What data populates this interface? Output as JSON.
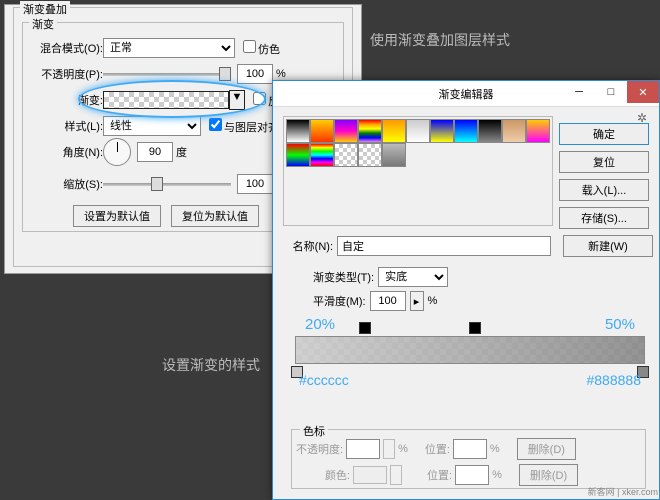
{
  "panel": {
    "title": "渐变叠加",
    "inner": "渐变",
    "blend": {
      "label": "混合模式(O):",
      "value": "正常",
      "dither": "仿色"
    },
    "opacity": {
      "label": "不透明度(P):",
      "value": "100",
      "unit": "%"
    },
    "gradient": {
      "label": "渐变:",
      "reverse": "反向(R)"
    },
    "style": {
      "label": "样式(L):",
      "value": "线性",
      "align": "与图层对齐(I)"
    },
    "angle": {
      "label": "角度(N):",
      "value": "90",
      "unit": "度"
    },
    "scale": {
      "label": "缩放(S):",
      "value": "100",
      "unit": "%"
    },
    "setDefault": "设置为默认值",
    "resetDefault": "复位为默认值"
  },
  "anno1": "使用渐变叠加图层样式",
  "anno2": "设置渐变的样式",
  "editor": {
    "title": "渐变编辑器",
    "ok": "确定",
    "cancel": "复位",
    "load": "载入(L)...",
    "save": "存储(S)...",
    "new": "新建(W)",
    "name": {
      "label": "名称(N):",
      "value": "自定"
    },
    "type": {
      "label": "渐变类型(T):",
      "value": "实底"
    },
    "smooth": {
      "label": "平滑度(M):",
      "value": "100",
      "unit": "%"
    },
    "stops": {
      "p1": "20%",
      "p2": "50%",
      "c1": "#cccccc",
      "c2": "#888888"
    },
    "colorstop": {
      "title": "色标",
      "opLabel": "不透明度:",
      "opUnit": "%",
      "posLabel": "位置:",
      "posUnit": "%",
      "del": "删除(D)",
      "colorLabel": "颜色:"
    }
  },
  "watermark": "新客网 | xker.com"
}
